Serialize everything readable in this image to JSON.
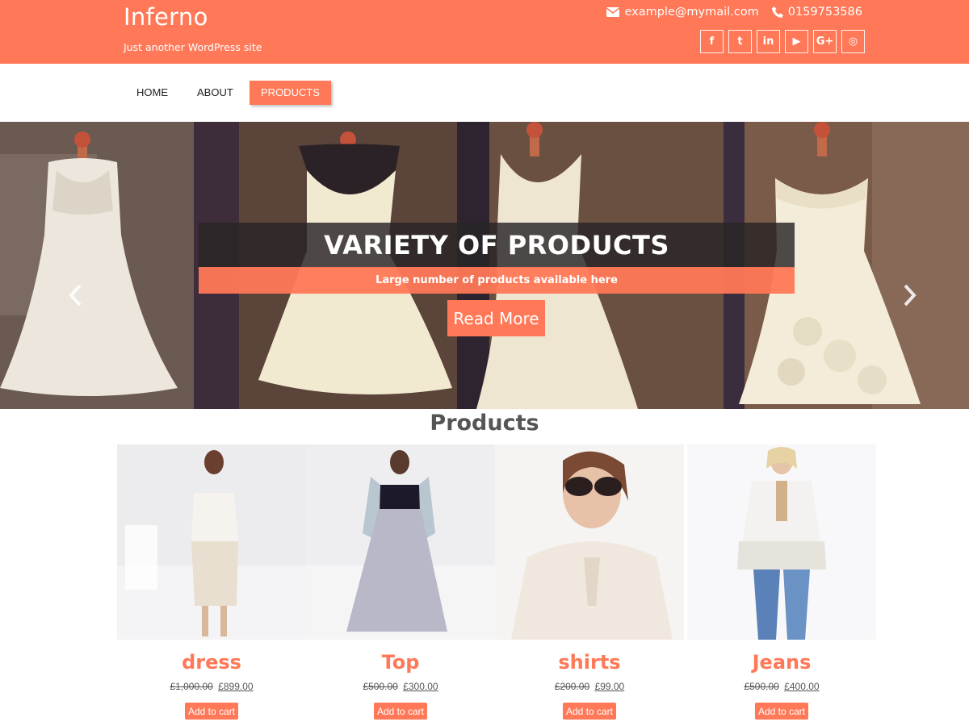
{
  "header": {
    "site_title": "Inferno",
    "tagline": "Just another WordPress site",
    "email": "example@mymail.com",
    "phone": "0159753586",
    "socials": [
      {
        "icon": "facebook-icon",
        "glyph": "f"
      },
      {
        "icon": "twitter-icon",
        "glyph": "t"
      },
      {
        "icon": "linkedin-icon",
        "glyph": "in"
      },
      {
        "icon": "youtube-icon",
        "glyph": "▶"
      },
      {
        "icon": "google-plus-icon",
        "glyph": "G+"
      },
      {
        "icon": "instagram-icon",
        "glyph": "◎"
      }
    ],
    "accent_color": "#ff7857"
  },
  "nav": {
    "items": [
      {
        "label": "HOME"
      },
      {
        "label": "ABOUT"
      },
      {
        "label": "PRODUCTS",
        "active": true
      }
    ]
  },
  "hero": {
    "title": "VARIETY OF PRODUCTS",
    "subtitle": "Large number of products available here",
    "button_label": "Read More",
    "prev_icon": "chevron-left-icon",
    "next_icon": "chevron-right-icon"
  },
  "products": {
    "heading": "Products",
    "items": [
      {
        "name": "dress",
        "regular_price": "£1,000.00",
        "sale_price": "£899.00",
        "cart_label": "Add to cart"
      },
      {
        "name": "Top",
        "regular_price": "£500.00",
        "sale_price": "£300.00",
        "cart_label": "Add to cart"
      },
      {
        "name": "shirts",
        "regular_price": "£200.00",
        "sale_price": "£99.00",
        "cart_label": "Add to cart"
      },
      {
        "name": "Jeans",
        "regular_price": "£500.00",
        "sale_price": "£400.00",
        "cart_label": "Add to cart"
      }
    ]
  }
}
